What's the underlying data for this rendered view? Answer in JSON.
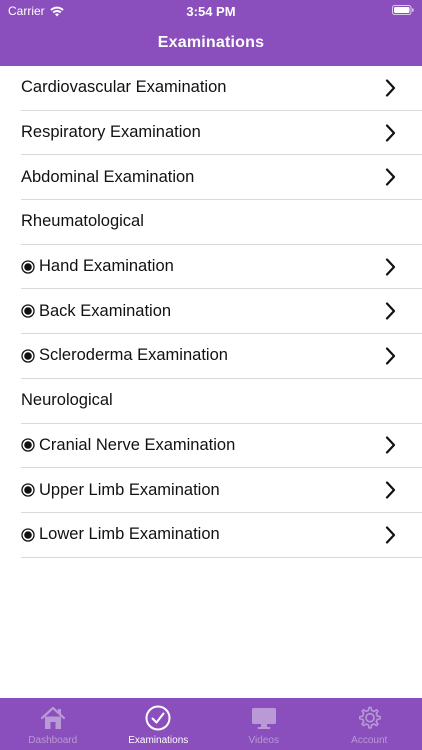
{
  "status_bar": {
    "carrier": "Carrier",
    "time": "3:54 PM"
  },
  "nav": {
    "title": "Examinations"
  },
  "colors": {
    "brand": "#8a4fbd",
    "tab_inactive": "#b999d6",
    "tab_active": "#ffffff",
    "separator": "#d9d9d9"
  },
  "list": [
    {
      "label": "Cardiovascular Examination",
      "bullet": false,
      "chevron": true
    },
    {
      "label": "Respiratory Examination",
      "bullet": false,
      "chevron": true
    },
    {
      "label": "Abdominal Examination",
      "bullet": false,
      "chevron": true
    },
    {
      "label": "Rheumatological",
      "bullet": false,
      "chevron": false
    },
    {
      "label": "Hand Examination",
      "bullet": true,
      "chevron": true
    },
    {
      "label": "Back Examination",
      "bullet": true,
      "chevron": true
    },
    {
      "label": "Scleroderma Examination",
      "bullet": true,
      "chevron": true
    },
    {
      "label": "Neurological",
      "bullet": false,
      "chevron": false
    },
    {
      "label": "Cranial Nerve Examination",
      "bullet": true,
      "chevron": true
    },
    {
      "label": "Upper Limb Examination",
      "bullet": true,
      "chevron": true
    },
    {
      "label": "Lower Limb Examination",
      "bullet": true,
      "chevron": true
    }
  ],
  "tabs": [
    {
      "label": "Dashboard",
      "icon": "home-icon",
      "active": false
    },
    {
      "label": "Examinations",
      "icon": "checkmark-circle-icon",
      "active": true
    },
    {
      "label": "Videos",
      "icon": "monitor-icon",
      "active": false
    },
    {
      "label": "Account",
      "icon": "gear-icon",
      "active": false
    }
  ]
}
